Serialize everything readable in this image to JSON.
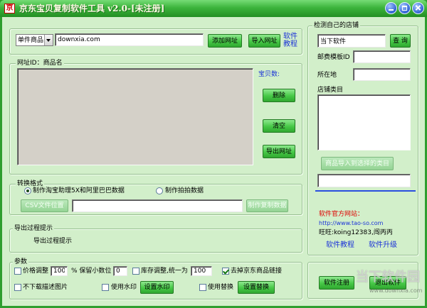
{
  "window": {
    "title": "京东宝贝复制软件工具 v2.0-[未注册]",
    "logo_text": "京"
  },
  "colors": {
    "frame": "#2e9e2e",
    "title_bar": "#3cb43c",
    "title_text": "#fffbe6",
    "body": "#d2efca",
    "button": "#46c846",
    "link": "#1a32d8",
    "accent_red": "#e00000",
    "list_gray": "#d4d0c8",
    "separator": "#2a4ee0"
  },
  "icons": {
    "logo": "app-logo-icon",
    "minimize": "minimize-icon",
    "maximize": "maximize-icon",
    "close": "close-icon",
    "dropdown": "chevron-down-icon"
  },
  "source": {
    "product_type_selected": "单件商品",
    "url_value": "downxia.com",
    "add_url_button": "添加网址",
    "import_url_button": "导入网址",
    "tutorial_link": "软件教程"
  },
  "url_list": {
    "title": "网址ID：商品名",
    "count_label": "宝贝数:",
    "delete_button": "删除",
    "clear_button": "清空",
    "export_button": "导出网址"
  },
  "convert": {
    "title": "转换格式",
    "options": [
      {
        "label": "制作淘宝助理5X和阿里巴巴数据",
        "selected": true
      },
      {
        "label": "制作拍拍数据",
        "selected": false
      }
    ],
    "csv_button": "CSV文件位置",
    "make_button": "制作复制数据"
  },
  "export_log": {
    "title": "导出过程提示",
    "message": "导出过程提示"
  },
  "params": {
    "title": "参数",
    "price_adjust": {
      "label": "价格调整",
      "checked": false,
      "value": "100"
    },
    "percent_decimal_label": "% 保留小数位",
    "decimal_value": "0",
    "stock_adjust": {
      "label": "库存调整,统一为",
      "checked": false,
      "value": "100"
    },
    "remove_jd_links": {
      "label": "去掉京东商品链接",
      "checked": true
    },
    "no_desc_images": {
      "label": "不下载描述图片",
      "checked": false
    },
    "watermark": {
      "label": "使用水印",
      "checked": false,
      "button": "设置水印"
    },
    "replace": {
      "label": "使用替换",
      "checked": false,
      "button": "设置替换"
    }
  },
  "shop": {
    "title": "检测自己的店铺",
    "shop_name_value": "当下软件",
    "query_button": "查 询",
    "postage_label": "邮费模板ID",
    "location_label": "所在地",
    "category_label": "店铺类目",
    "import_to_category_button": "商品导入到选择的类目"
  },
  "contact": {
    "site_label": "软件官方网站：",
    "site_url": "http://www.tao-so.com",
    "wangwang": "旺旺:koing12383,闯丙丙",
    "tutorial_link": "软件教程",
    "upgrade_link": "软件升级"
  },
  "footer": {
    "register_button": "软件注册",
    "exit_button": "退出软件"
  },
  "watermark_overlay": {
    "brand": "当下软件园",
    "url": "www.downxia.com"
  }
}
